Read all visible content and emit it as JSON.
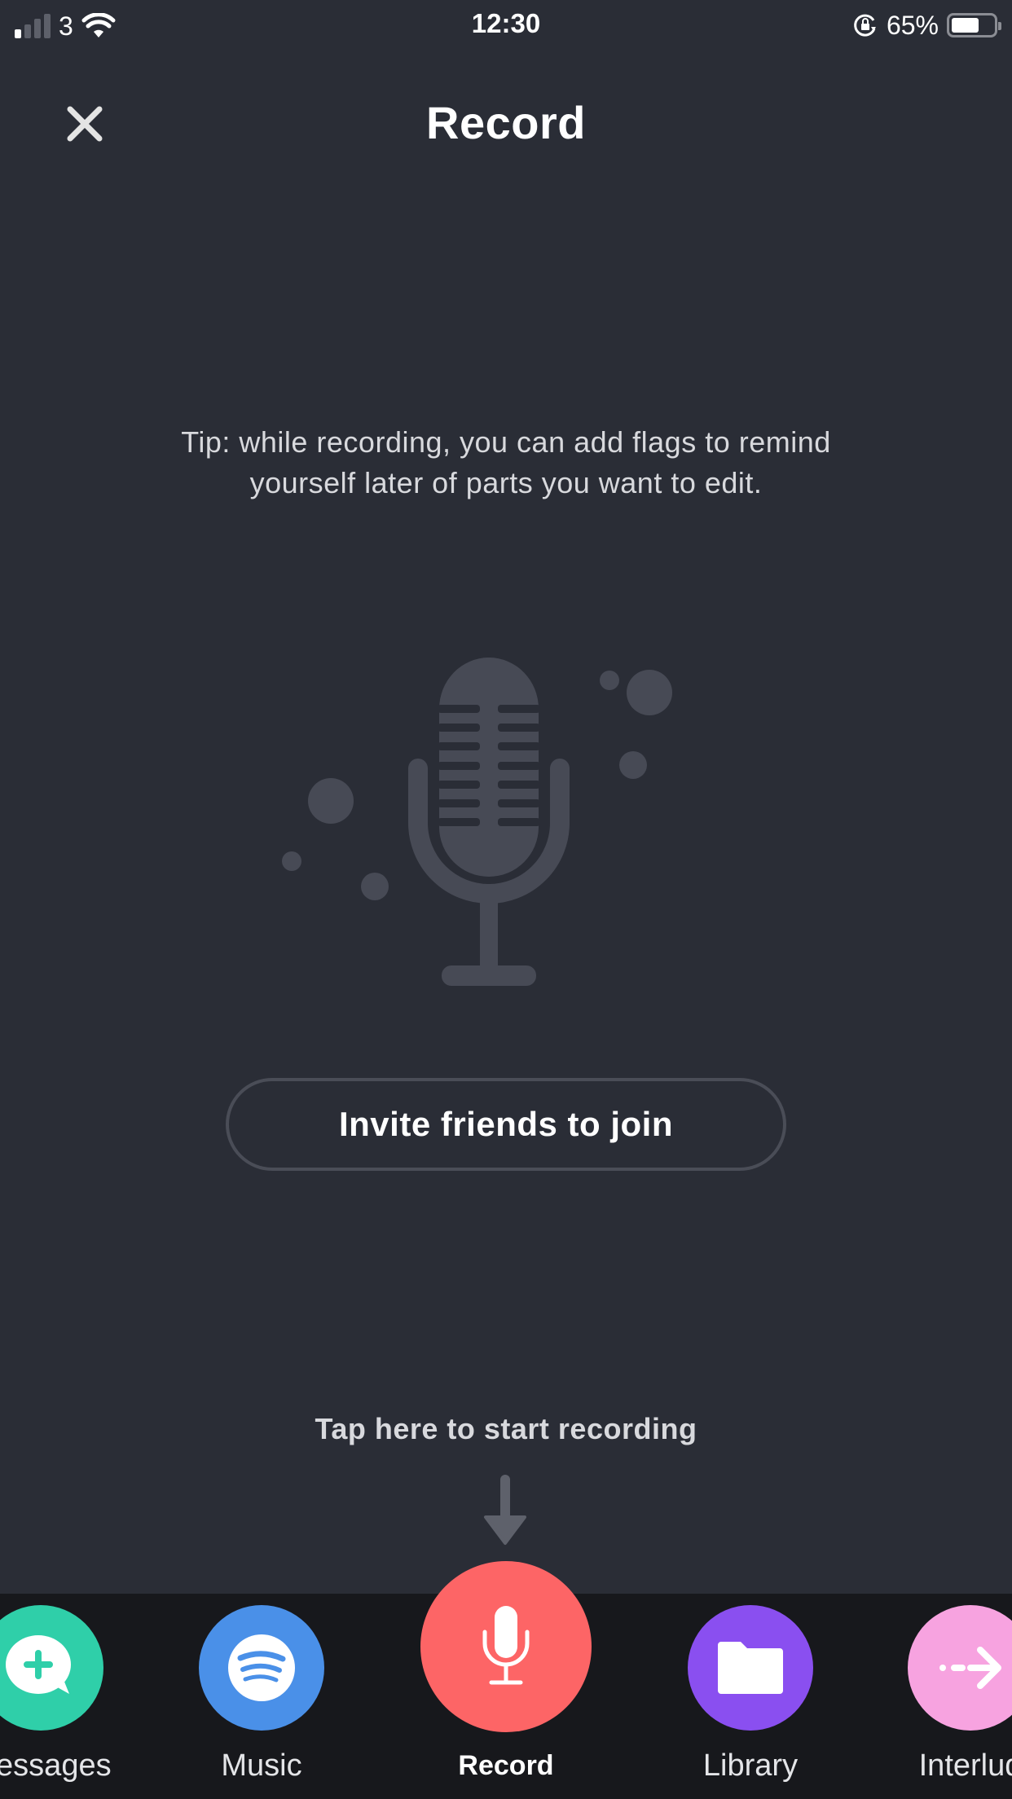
{
  "status_bar": {
    "carrier": "3",
    "time": "12:30",
    "battery_percent_label": "65%",
    "battery_level": 0.65,
    "signal_bars_active": 1,
    "signal_bars_total": 4,
    "icons": [
      "signal-icon",
      "wifi-icon",
      "rotation-lock-icon",
      "battery-icon"
    ]
  },
  "header": {
    "title": "Record",
    "close_icon": "close-icon"
  },
  "tip": {
    "text": "Tip: while recording, you can add flags to remind yourself later of parts you want to edit."
  },
  "illustration": {
    "icon": "microphone-illustration"
  },
  "invite_button": {
    "label": "Invite friends to join"
  },
  "start_hint": {
    "text": "Tap here to start recording",
    "icon": "arrow-down-icon"
  },
  "bottom_nav": {
    "tabs": [
      {
        "label": "Messages",
        "icon": "message-plus-icon",
        "color": "#2fcfa9"
      },
      {
        "label": "Music",
        "icon": "spotify-icon",
        "color": "#4a90e8"
      },
      {
        "label": "Record",
        "icon": "microphone-icon",
        "color": "#fd6566",
        "active": true
      },
      {
        "label": "Library",
        "icon": "folder-icon",
        "color": "#8a4ff0"
      },
      {
        "label": "Interlud",
        "icon": "dashed-arrow-right-icon",
        "color": "#f7a3e0"
      }
    ]
  },
  "colors": {
    "background": "#2a2d36",
    "bottom_bar": "#17181c",
    "illustration": "#494c57",
    "record_accent": "#fd6566"
  }
}
